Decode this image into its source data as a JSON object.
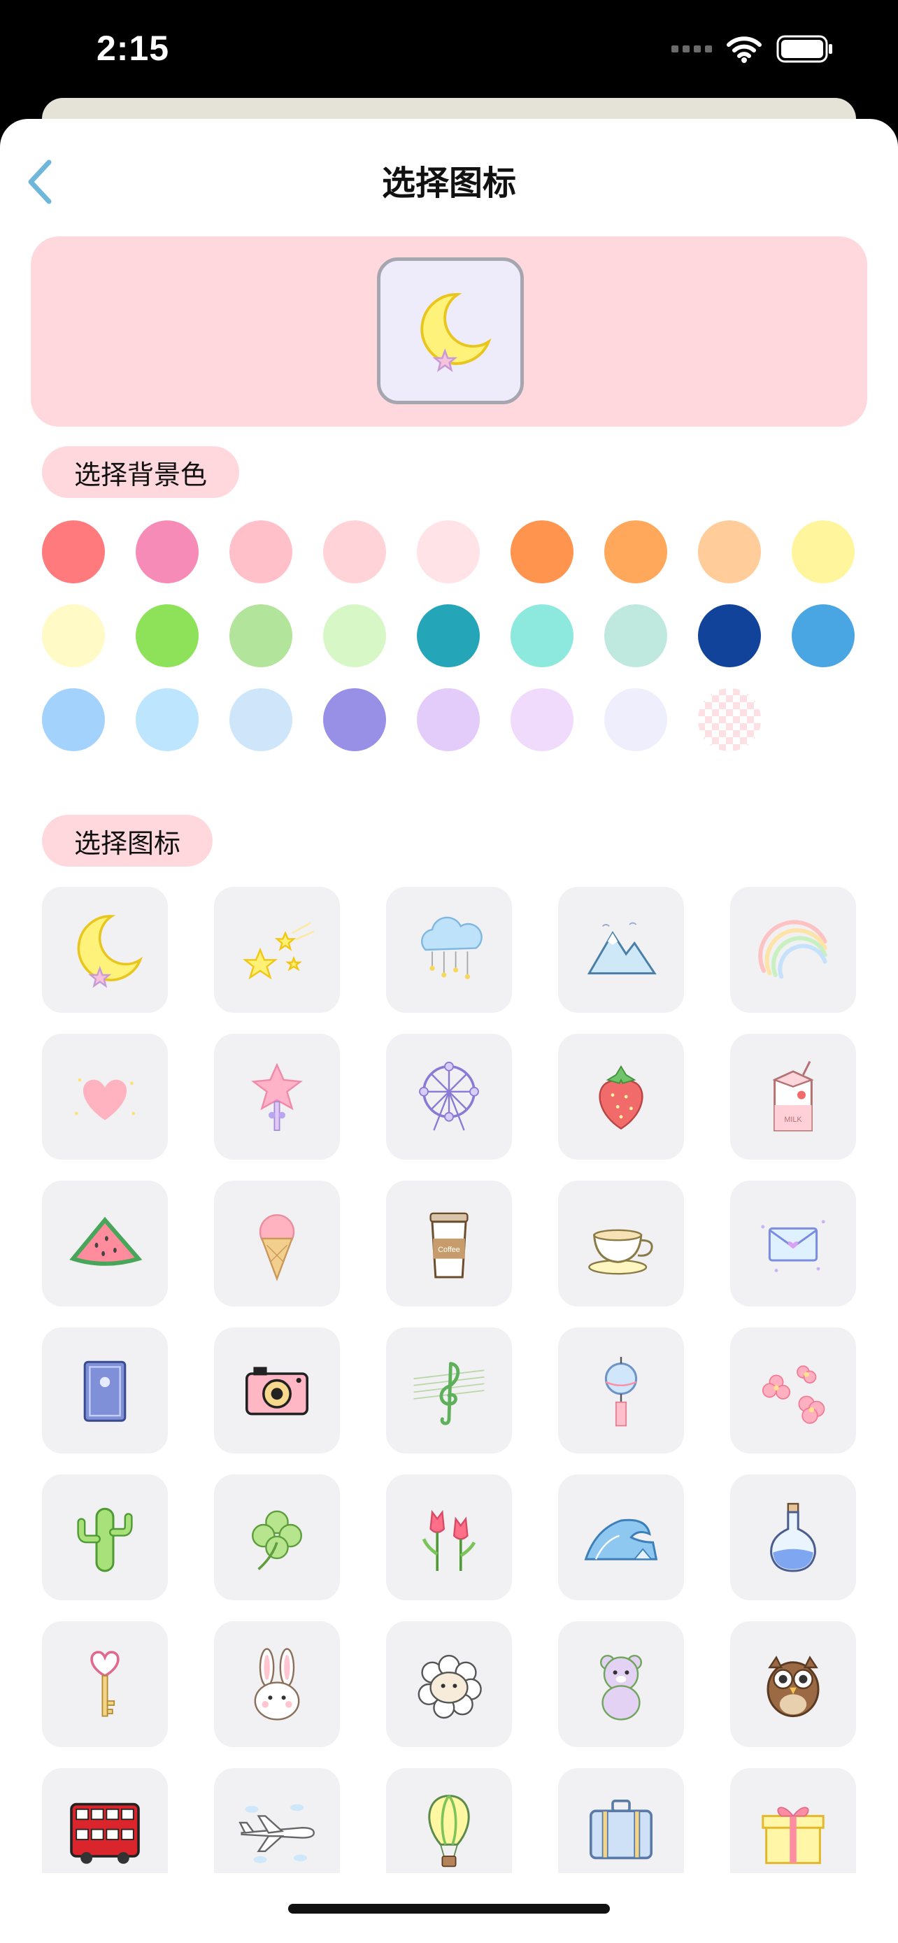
{
  "status_bar": {
    "time": "2:15"
  },
  "nav": {
    "title": "选择图标"
  },
  "preview": {
    "icon": "moon-icon",
    "icon_bg": "#eeecfb"
  },
  "background_section": {
    "label": "选择背景色",
    "colors": [
      "#ff7a7d",
      "#f78bb7",
      "#ffc0c9",
      "#ffd3d8",
      "#ffe3e6",
      "#ff944f",
      "#ffa75a",
      "#ffcc9a",
      "#fff59c",
      "#fffac6",
      "#8de25a",
      "#b2e59b",
      "#d8f7c6",
      "#25a6b8",
      "#8de8de",
      "#bfe9de",
      "#12439a",
      "#4aa6e2",
      "#a3d2fd",
      "#bde6fe",
      "#cfe5fa",
      "#9890e6",
      "#e3ccfa",
      "#f0dbfd",
      "#efeefc",
      "transparent"
    ]
  },
  "icon_section": {
    "label": "选择图标",
    "icons": [
      "moon-icon",
      "shooting-stars-icon",
      "rain-cloud-icon",
      "mountain-icon",
      "rainbow-icon",
      "heart-icon",
      "star-wand-icon",
      "ferris-wheel-icon",
      "strawberry-icon",
      "milk-carton-icon",
      "watermelon-icon",
      "ice-cream-icon",
      "coffee-cup-icon",
      "teacup-icon",
      "envelope-icon",
      "book-icon",
      "camera-icon",
      "music-note-icon",
      "wind-chime-icon",
      "sakura-icon",
      "cactus-icon",
      "clover-icon",
      "tulip-icon",
      "wave-icon",
      "potion-bottle-icon",
      "heart-key-icon",
      "bunny-icon",
      "sheep-icon",
      "bear-icon",
      "owl-icon",
      "bus-icon",
      "airplane-icon",
      "hot-air-balloon-icon",
      "suitcase-icon",
      "gift-icon"
    ],
    "coffee_text": "Coffee",
    "milk_text": "MILK"
  }
}
